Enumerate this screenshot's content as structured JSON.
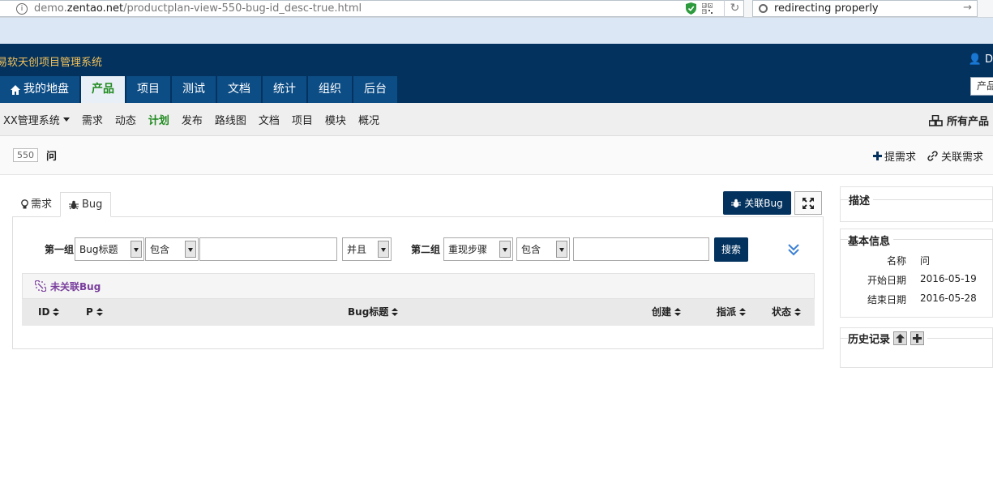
{
  "browser": {
    "url_prefix": "demo.",
    "url_domain": "zentao.net",
    "url_path": "/productplan-view-550-bug-id_desc-true.html",
    "search_text": "redirecting properly"
  },
  "app": {
    "title": "易软天创项目管理系统",
    "user_initial": "D",
    "product_pill": "产品"
  },
  "mainnav": [
    {
      "label": "我的地盘",
      "icon": "home-icon",
      "active": false
    },
    {
      "label": "产品",
      "active": true
    },
    {
      "label": "项目",
      "active": false
    },
    {
      "label": "测试",
      "active": false
    },
    {
      "label": "文档",
      "active": false
    },
    {
      "label": "统计",
      "active": false
    },
    {
      "label": "组织",
      "active": false
    },
    {
      "label": "后台",
      "active": false
    }
  ],
  "subnav": {
    "product": "XX管理系统",
    "items": [
      "需求",
      "动态",
      "计划",
      "发布",
      "路线图",
      "文档",
      "项目",
      "模块",
      "概况"
    ],
    "active_index": 2,
    "all_products": "所有产品"
  },
  "plan": {
    "id": "550",
    "name": "问",
    "actions": [
      "提需求",
      "关联需求"
    ]
  },
  "tabs": [
    {
      "label": "需求",
      "icon": "lightbulb-icon"
    },
    {
      "label": "Bug",
      "icon": "bug-icon"
    }
  ],
  "panel": {
    "link_bug": "关联Bug"
  },
  "search": {
    "group1": "第一组",
    "field1": "Bug标题",
    "op1": "包含",
    "value1": "",
    "logic": "并且",
    "group2": "第二组",
    "field2": "重现步骤",
    "op2": "包含",
    "value2": "",
    "button": "搜索"
  },
  "unlinked_label": "未关联Bug",
  "table": {
    "headers": [
      "ID",
      "P",
      "Bug标题",
      "创建",
      "指派",
      "状态"
    ]
  },
  "side": {
    "desc_title": "描述",
    "basic_title": "基本信息",
    "rows": [
      {
        "key": "名称",
        "value": "问"
      },
      {
        "key": "开始日期",
        "value": "2016-05-19"
      },
      {
        "key": "结束日期",
        "value": "2016-05-28"
      }
    ],
    "history_title": "历史记录"
  },
  "colors": {
    "header_bg": "#03325e",
    "nav_bg": "#0d4d86",
    "active_green": "#1f8a1f",
    "title_yellow": "#f4c25a",
    "unlinked_purple": "#7a3e9d"
  }
}
